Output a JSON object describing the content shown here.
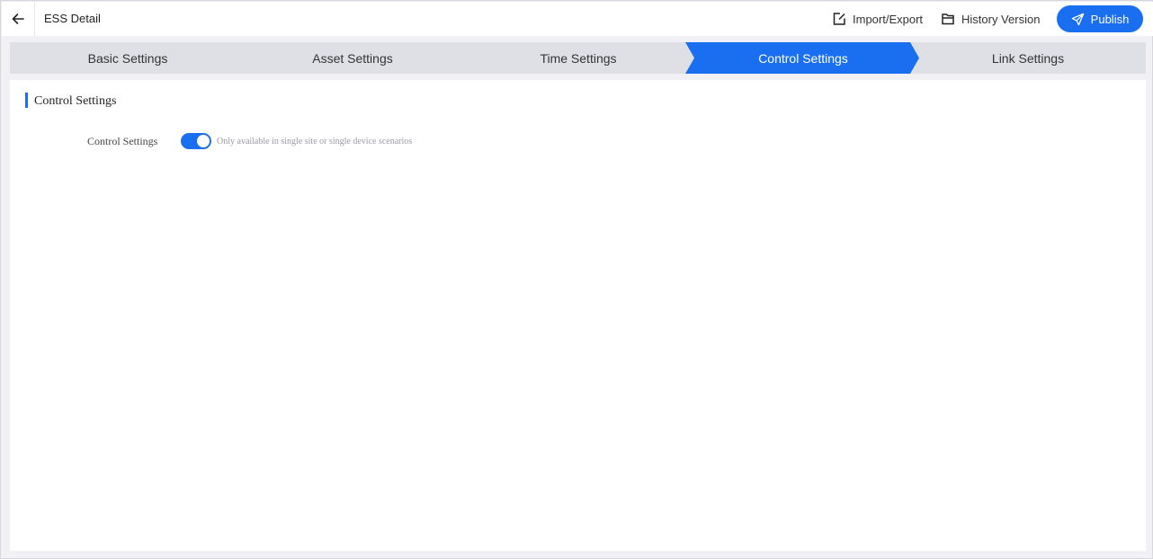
{
  "header": {
    "title": "ESS Detail",
    "import_export_label": "Import/Export",
    "history_label": "History Version",
    "publish_label": "Publish"
  },
  "steps": [
    {
      "label": "Basic Settings",
      "active": false
    },
    {
      "label": "Asset Settings",
      "active": false
    },
    {
      "label": "Time Settings",
      "active": false
    },
    {
      "label": "Control Settings",
      "active": true
    },
    {
      "label": "Link Settings",
      "active": false
    }
  ],
  "section": {
    "title": "Control Settings",
    "control_label": "Control Settings",
    "control_enabled": true,
    "hint": "Only available in single site or single device scenarios"
  },
  "colors": {
    "accent": "#1a6ff0",
    "step_inactive": "#dfe0e6",
    "page_bg": "#f0f0f5"
  },
  "icons": {
    "back": "arrow-left-icon",
    "import_export": "edit-box-icon",
    "history": "folder-icon",
    "publish": "send-icon"
  }
}
